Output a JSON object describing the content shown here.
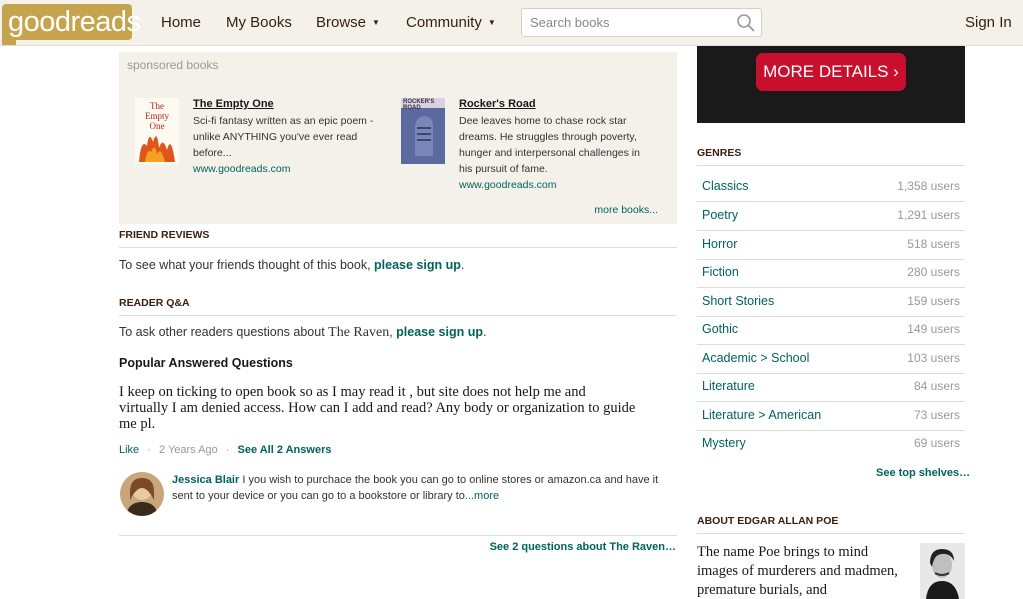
{
  "header": {
    "logo_text": "goodreads",
    "nav": {
      "home": "Home",
      "my_books": "My Books",
      "browse": "Browse",
      "community": "Community"
    },
    "caret": "▼",
    "search_placeholder": "Search books",
    "sign_in": "Sign In"
  },
  "sponsored": {
    "title": "sponsored books",
    "ads": [
      {
        "cover_text_line1": "The Empty",
        "cover_text_line2": "One",
        "title": "The Empty One",
        "desc_lines": [
          "Sci-fi fantasy written as an epic poem -",
          "unlike ANYTHING you've ever read",
          "before..."
        ],
        "url": "www.goodreads.com"
      },
      {
        "cover_text": "ROCKER'S ROAD",
        "title": "Rocker's Road",
        "desc_lines": [
          "Dee leaves home to chase rock star",
          "dreams. He struggles through poverty,",
          "hunger and interpersonal challenges in",
          "his pursuit of fame."
        ],
        "url": "www.goodreads.com"
      }
    ],
    "more_books": "more books..."
  },
  "friend_reviews": {
    "header": "FRIEND REVIEWS",
    "text": "To see what your friends thought of this book, ",
    "link": "please sign up",
    "end": "."
  },
  "reader_qa": {
    "header": "READER Q&A",
    "text": "To ask other readers questions about ",
    "book_title": "The Raven",
    "comma": ", ",
    "link": "please sign up",
    "end": ".",
    "popular_label": "Popular Answered Questions",
    "question_lines": [
      "I keep on ticking to open book so as I may read it , but site does not help me and",
      "virtually I am denied access. How can I add and read? Any body or organization to guide",
      "me pl."
    ],
    "like": "Like",
    "sep": "·",
    "age": "2 Years Ago",
    "see_all": "See All 2 Answers",
    "answer": {
      "name": "Jessica Blair",
      "text": " I you wish to purchace the book you can go to online stores or amazon.ca and have it sent to your device or you can go to a bookstore or library to",
      "more": "...more"
    },
    "see_questions": "See 2 questions about The Raven…"
  },
  "promo": {
    "button": "MORE DETAILS ›"
  },
  "genres": {
    "header": "GENRES",
    "items": [
      {
        "name": "Classics",
        "count": "1,358 users"
      },
      {
        "name": "Poetry",
        "count": "1,291 users"
      },
      {
        "name": "Horror",
        "count": "518 users"
      },
      {
        "name": "Fiction",
        "count": "280 users"
      },
      {
        "name": "Short Stories",
        "count": "159 users"
      },
      {
        "name": "Gothic",
        "count": "149 users"
      },
      {
        "name": "Academic > School",
        "count": "103 users"
      },
      {
        "name": "Literature",
        "count": "84 users"
      },
      {
        "name": "Literature > American",
        "count": "73 users"
      },
      {
        "name": "Mystery",
        "count": "69 users"
      }
    ],
    "see_top": "See top shelves…"
  },
  "author": {
    "header": "ABOUT EDGAR ALLAN POE",
    "bio": "The name Poe brings to mind images of murderers and madmen, premature burials, and"
  },
  "colors": {
    "header_bg": "#f4f1ea",
    "link_green": "#00635d",
    "logo_gold": "#c6a44d",
    "promo_red": "#c8102e"
  }
}
